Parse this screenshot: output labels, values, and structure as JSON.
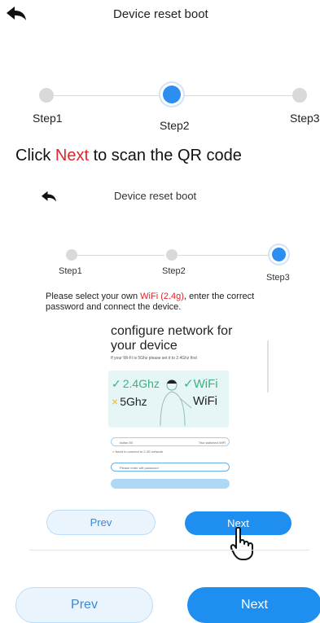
{
  "outer": {
    "title": "Device reset boot",
    "steps": [
      "Step1",
      "Step2",
      "Step3"
    ],
    "active_step": 2,
    "instruction_prefix": "Click ",
    "instruction_highlight": "Next",
    "instruction_suffix": " to scan the QR code",
    "prev_label": "Prev",
    "next_label": "Next"
  },
  "inner": {
    "title": "Device reset boot",
    "steps": [
      "Step1",
      "Step2",
      "Step3"
    ],
    "active_step": 3,
    "desc_prefix": "Please select your own ",
    "desc_highlight": "WiFi (2.4g)",
    "desc_suffix": ", enter the correct password and connect the device.",
    "card_title": "configure network for your device",
    "card_note": "If your Wi-Fi is 5Ghz please set it to 2.4Ghz first",
    "band_ok": "2.4Ghz",
    "band_bad": "5Ghz",
    "wifi_word": "WiFi",
    "wifi_field": "ksifan 50",
    "wifi_field_tag": "Two switched WiFi",
    "warning": "Need to connect to 2.4G network",
    "password_placeholder": "Please enter wifi password",
    "prev_label": "Prev",
    "next_label": "Next"
  },
  "colors": {
    "accent": "#1f8ef1",
    "highlight_red": "#e0242b",
    "step_inactive": "#d9d9d9"
  }
}
